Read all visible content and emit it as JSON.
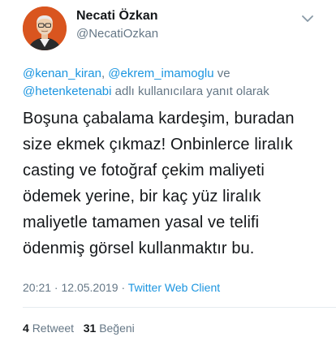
{
  "author": {
    "name": "Necati Özkan",
    "handle": "@NecatiOzkan"
  },
  "reply_context": {
    "mention_1": "@kenan_kiran",
    "sep_1": ", ",
    "mention_2": "@ekrem_imamoglu",
    "sep_2": " ve ",
    "mention_3": "@hetenketenabi",
    "suffix": " adlı kullanıcılara yanıt olarak"
  },
  "tweet_lines": [
    "Boşuna çabalama kardeşim, buradan",
    "size ekmek çıkmaz! Onbinlerce liralık",
    "casting ve fotoğraf çekim maliyeti",
    "ödemek yerine, bir kaç yüz liralık",
    "maliyetle tamamen yasal ve telifi",
    "ödenmiş görsel kullanmaktır bu."
  ],
  "meta": {
    "time": "20:21",
    "date": "12.05.2019",
    "separator": " · ",
    "client": "Twitter Web Client"
  },
  "stats": {
    "retweets_count": "4",
    "retweets_label": "Retweet",
    "likes_count": "31",
    "likes_label": "Beğeni"
  },
  "icons": {
    "menu": "chevron-down-icon",
    "avatar": "profile-photo"
  },
  "colors": {
    "text": "#14171a",
    "secondary": "#657786",
    "link": "#1b95e0",
    "divider": "#e6ecf0"
  }
}
